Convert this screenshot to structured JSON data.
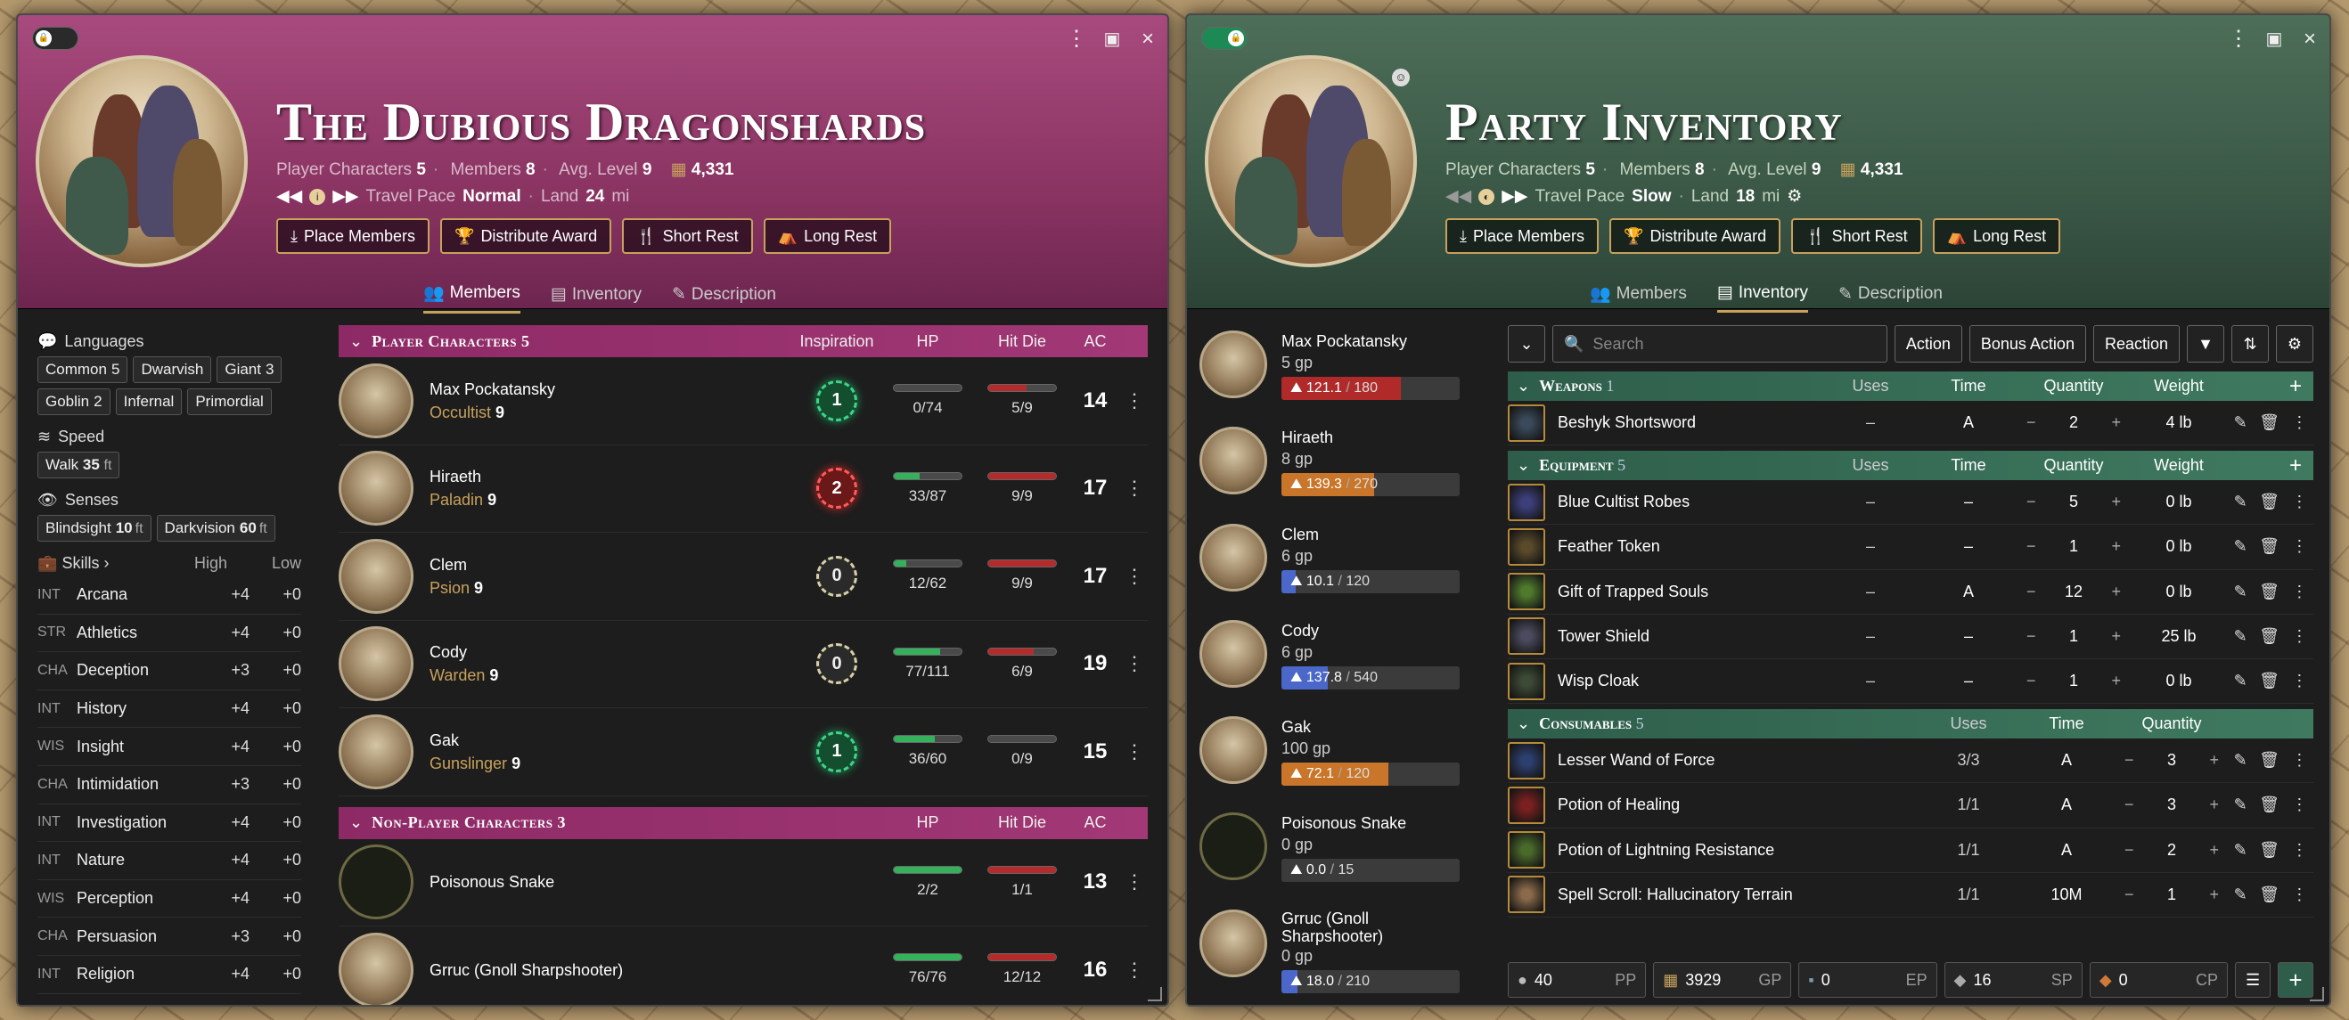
{
  "left": {
    "title": "The Dubious Dragonshards",
    "stats": {
      "pc_label": "Player Characters",
      "pc": "5",
      "members_label": "Members",
      "members": "8",
      "avg_label": "Avg. Level",
      "avg": "9",
      "xp": "4,331"
    },
    "pace": {
      "label": "Travel Pace",
      "value": "Normal",
      "land_label": "Land",
      "land": "24",
      "land_unit": "mi"
    },
    "buttons": [
      "Place Members",
      "Distribute Award",
      "Short Rest",
      "Long Rest"
    ],
    "tabs": [
      "Members",
      "Inventory",
      "Description"
    ],
    "languages_label": "Languages",
    "languages": [
      {
        "n": "Common",
        "v": "5"
      },
      {
        "n": "Dwarvish",
        "v": ""
      },
      {
        "n": "Giant",
        "v": "3"
      },
      {
        "n": "Goblin",
        "v": "2"
      },
      {
        "n": "Infernal",
        "v": ""
      },
      {
        "n": "Primordial",
        "v": ""
      }
    ],
    "speed_label": "Speed",
    "speed": {
      "n": "Walk",
      "v": "35",
      "u": "ft"
    },
    "senses_label": "Senses",
    "senses": [
      {
        "n": "Blindsight",
        "v": "10",
        "u": "ft"
      },
      {
        "n": "Darkvision",
        "v": "60",
        "u": "ft"
      }
    ],
    "skills_label": "Skills",
    "high_label": "High",
    "low_label": "Low",
    "skills": [
      {
        "ab": "INT",
        "n": "Arcana",
        "h": "+4",
        "l": "+0"
      },
      {
        "ab": "STR",
        "n": "Athletics",
        "h": "+4",
        "l": "+0"
      },
      {
        "ab": "CHA",
        "n": "Deception",
        "h": "+3",
        "l": "+0"
      },
      {
        "ab": "INT",
        "n": "History",
        "h": "+4",
        "l": "+0"
      },
      {
        "ab": "WIS",
        "n": "Insight",
        "h": "+4",
        "l": "+0"
      },
      {
        "ab": "CHA",
        "n": "Intimidation",
        "h": "+3",
        "l": "+0"
      },
      {
        "ab": "INT",
        "n": "Investigation",
        "h": "+4",
        "l": "+0"
      },
      {
        "ab": "INT",
        "n": "Nature",
        "h": "+4",
        "l": "+0"
      },
      {
        "ab": "WIS",
        "n": "Perception",
        "h": "+4",
        "l": "+0"
      },
      {
        "ab": "CHA",
        "n": "Persuasion",
        "h": "+3",
        "l": "+0"
      },
      {
        "ab": "INT",
        "n": "Religion",
        "h": "+4",
        "l": "+0"
      }
    ],
    "pc_section": {
      "title": "Player Characters",
      "count": "5",
      "insp": "Inspiration",
      "hp": "HP",
      "hd": "Hit Die",
      "ac": "AC"
    },
    "pcs": [
      {
        "name": "Max Pockatansky",
        "cls": "Occultist",
        "lvl": "9",
        "insp": "1",
        "insp_style": "g",
        "hp": "0/74",
        "hp_frac": 0,
        "hd": "5/9",
        "hd_frac": 0.56,
        "ac": "14"
      },
      {
        "name": "Hiraeth",
        "cls": "Paladin",
        "lvl": "9",
        "insp": "2",
        "insp_style": "r",
        "hp": "33/87",
        "hp_frac": 0.38,
        "hd": "9/9",
        "hd_frac": 1,
        "ac": "17"
      },
      {
        "name": "Clem",
        "cls": "Psion",
        "lvl": "9",
        "insp": "0",
        "insp_style": "z",
        "hp": "12/62",
        "hp_frac": 0.19,
        "hd": "9/9",
        "hd_frac": 1,
        "ac": "17"
      },
      {
        "name": "Cody",
        "cls": "Warden",
        "lvl": "9",
        "insp": "0",
        "insp_style": "z",
        "hp": "77/111",
        "hp_frac": 0.69,
        "hd": "6/9",
        "hd_frac": 0.67,
        "ac": "19"
      },
      {
        "name": "Gak",
        "cls": "Gunslinger",
        "lvl": "9",
        "insp": "1",
        "insp_style": "g",
        "hp": "36/60",
        "hp_frac": 0.6,
        "hd": "0/9",
        "hd_frac": 0,
        "ac": "15"
      }
    ],
    "npc_section": {
      "title": "Non-Player Characters",
      "count": "3",
      "hp": "HP",
      "hd": "Hit Die",
      "ac": "AC"
    },
    "npcs": [
      {
        "name": "Poisonous Snake",
        "hp": "2/2",
        "hp_frac": 1,
        "hd": "1/1",
        "hd_frac": 1,
        "ac": "13"
      },
      {
        "name": "Grruc (Gnoll Sharpshooter)",
        "hp": "76/76",
        "hp_frac": 1,
        "hd": "12/12",
        "hd_frac": 1,
        "ac": "16"
      }
    ]
  },
  "right": {
    "title": "Party Inventory",
    "stats": {
      "pc_label": "Player Characters",
      "pc": "5",
      "members_label": "Members",
      "members": "8",
      "avg_label": "Avg. Level",
      "avg": "9",
      "xp": "4,331"
    },
    "pace": {
      "label": "Travel Pace",
      "value": "Slow",
      "land_label": "Land",
      "land": "18",
      "land_unit": "mi"
    },
    "buttons": [
      "Place Members",
      "Distribute Award",
      "Short Rest",
      "Long Rest"
    ],
    "tabs": [
      "Members",
      "Inventory",
      "Description"
    ],
    "members": [
      {
        "name": "Max Pockatansky",
        "gp": "5 gp",
        "enc": "121.1",
        "cap": "180",
        "frac": 0.67,
        "color": "#b02a2a"
      },
      {
        "name": "Hiraeth",
        "gp": "8 gp",
        "enc": "139.3",
        "cap": "270",
        "frac": 0.52,
        "color": "#c9762a"
      },
      {
        "name": "Clem",
        "gp": "6 gp",
        "enc": "10.1",
        "cap": "120",
        "frac": 0.08,
        "color": "#4a67c9"
      },
      {
        "name": "Cody",
        "gp": "6 gp",
        "enc": "137.8",
        "cap": "540",
        "frac": 0.26,
        "color": "#4a67c9"
      },
      {
        "name": "Gak",
        "gp": "100 gp",
        "enc": "72.1",
        "cap": "120",
        "frac": 0.6,
        "color": "#c9762a"
      },
      {
        "name": "Poisonous Snake",
        "gp": "0 gp",
        "enc": "0.0",
        "cap": "15",
        "frac": 0,
        "color": "#4a67c9"
      },
      {
        "name": "Grruc (Gnoll Sharpshooter)",
        "gp": "0 gp",
        "enc": "18.0",
        "cap": "210",
        "frac": 0.09,
        "color": "#4a67c9"
      }
    ],
    "toolbar": {
      "search": "Search",
      "action": "Action",
      "bonus": "Bonus Action",
      "reaction": "Reaction"
    },
    "cols": {
      "uses": "Uses",
      "time": "Time",
      "qty": "Quantity",
      "wt": "Weight"
    },
    "sections": [
      {
        "title": "Weapons",
        "count": "1",
        "weight_col": true,
        "items": [
          {
            "n": "Beshyk Shortsword",
            "uses": "–",
            "time": "A",
            "q": "2",
            "w": "4 lb",
            "c": "#3a4a5a"
          }
        ]
      },
      {
        "title": "Equipment",
        "count": "5",
        "weight_col": true,
        "items": [
          {
            "n": "Blue Cultist Robes",
            "uses": "–",
            "time": "–",
            "q": "5",
            "w": "0 lb",
            "c": "#3c3f7a"
          },
          {
            "n": "Feather Token",
            "uses": "–",
            "time": "–",
            "q": "1",
            "w": "0 lb",
            "c": "#5a4a2a"
          },
          {
            "n": "Gift of Trapped Souls",
            "uses": "–",
            "time": "A",
            "q": "12",
            "w": "0 lb",
            "c": "#4f7a2c"
          },
          {
            "n": "Tower Shield",
            "uses": "–",
            "time": "–",
            "q": "1",
            "w": "25 lb",
            "c": "#4b4a5e"
          },
          {
            "n": "Wisp Cloak",
            "uses": "–",
            "time": "–",
            "q": "1",
            "w": "0 lb",
            "c": "#3d4a35"
          }
        ]
      },
      {
        "title": "Consumables",
        "count": "5",
        "weight_col": false,
        "items": [
          {
            "n": "Lesser Wand of Force",
            "uses": "3/3",
            "time": "A",
            "q": "3",
            "c": "#2c3f6e"
          },
          {
            "n": "Potion of Healing",
            "uses": "1/1",
            "time": "A",
            "q": "3",
            "c": "#7a2020"
          },
          {
            "n": "Potion of Lightning Resistance",
            "uses": "1/1",
            "time": "A",
            "q": "2",
            "c": "#4a6a2a"
          },
          {
            "n": "Spell Scroll: Hallucinatory Terrain",
            "uses": "1/1",
            "time": "10M",
            "q": "1",
            "c": "#8a6a4a"
          }
        ]
      }
    ],
    "currency": [
      {
        "v": "40",
        "u": "PP"
      },
      {
        "v": "3929",
        "u": "GP"
      },
      {
        "v": "0",
        "u": "EP"
      },
      {
        "v": "16",
        "u": "SP"
      },
      {
        "v": "0",
        "u": "CP"
      }
    ]
  }
}
